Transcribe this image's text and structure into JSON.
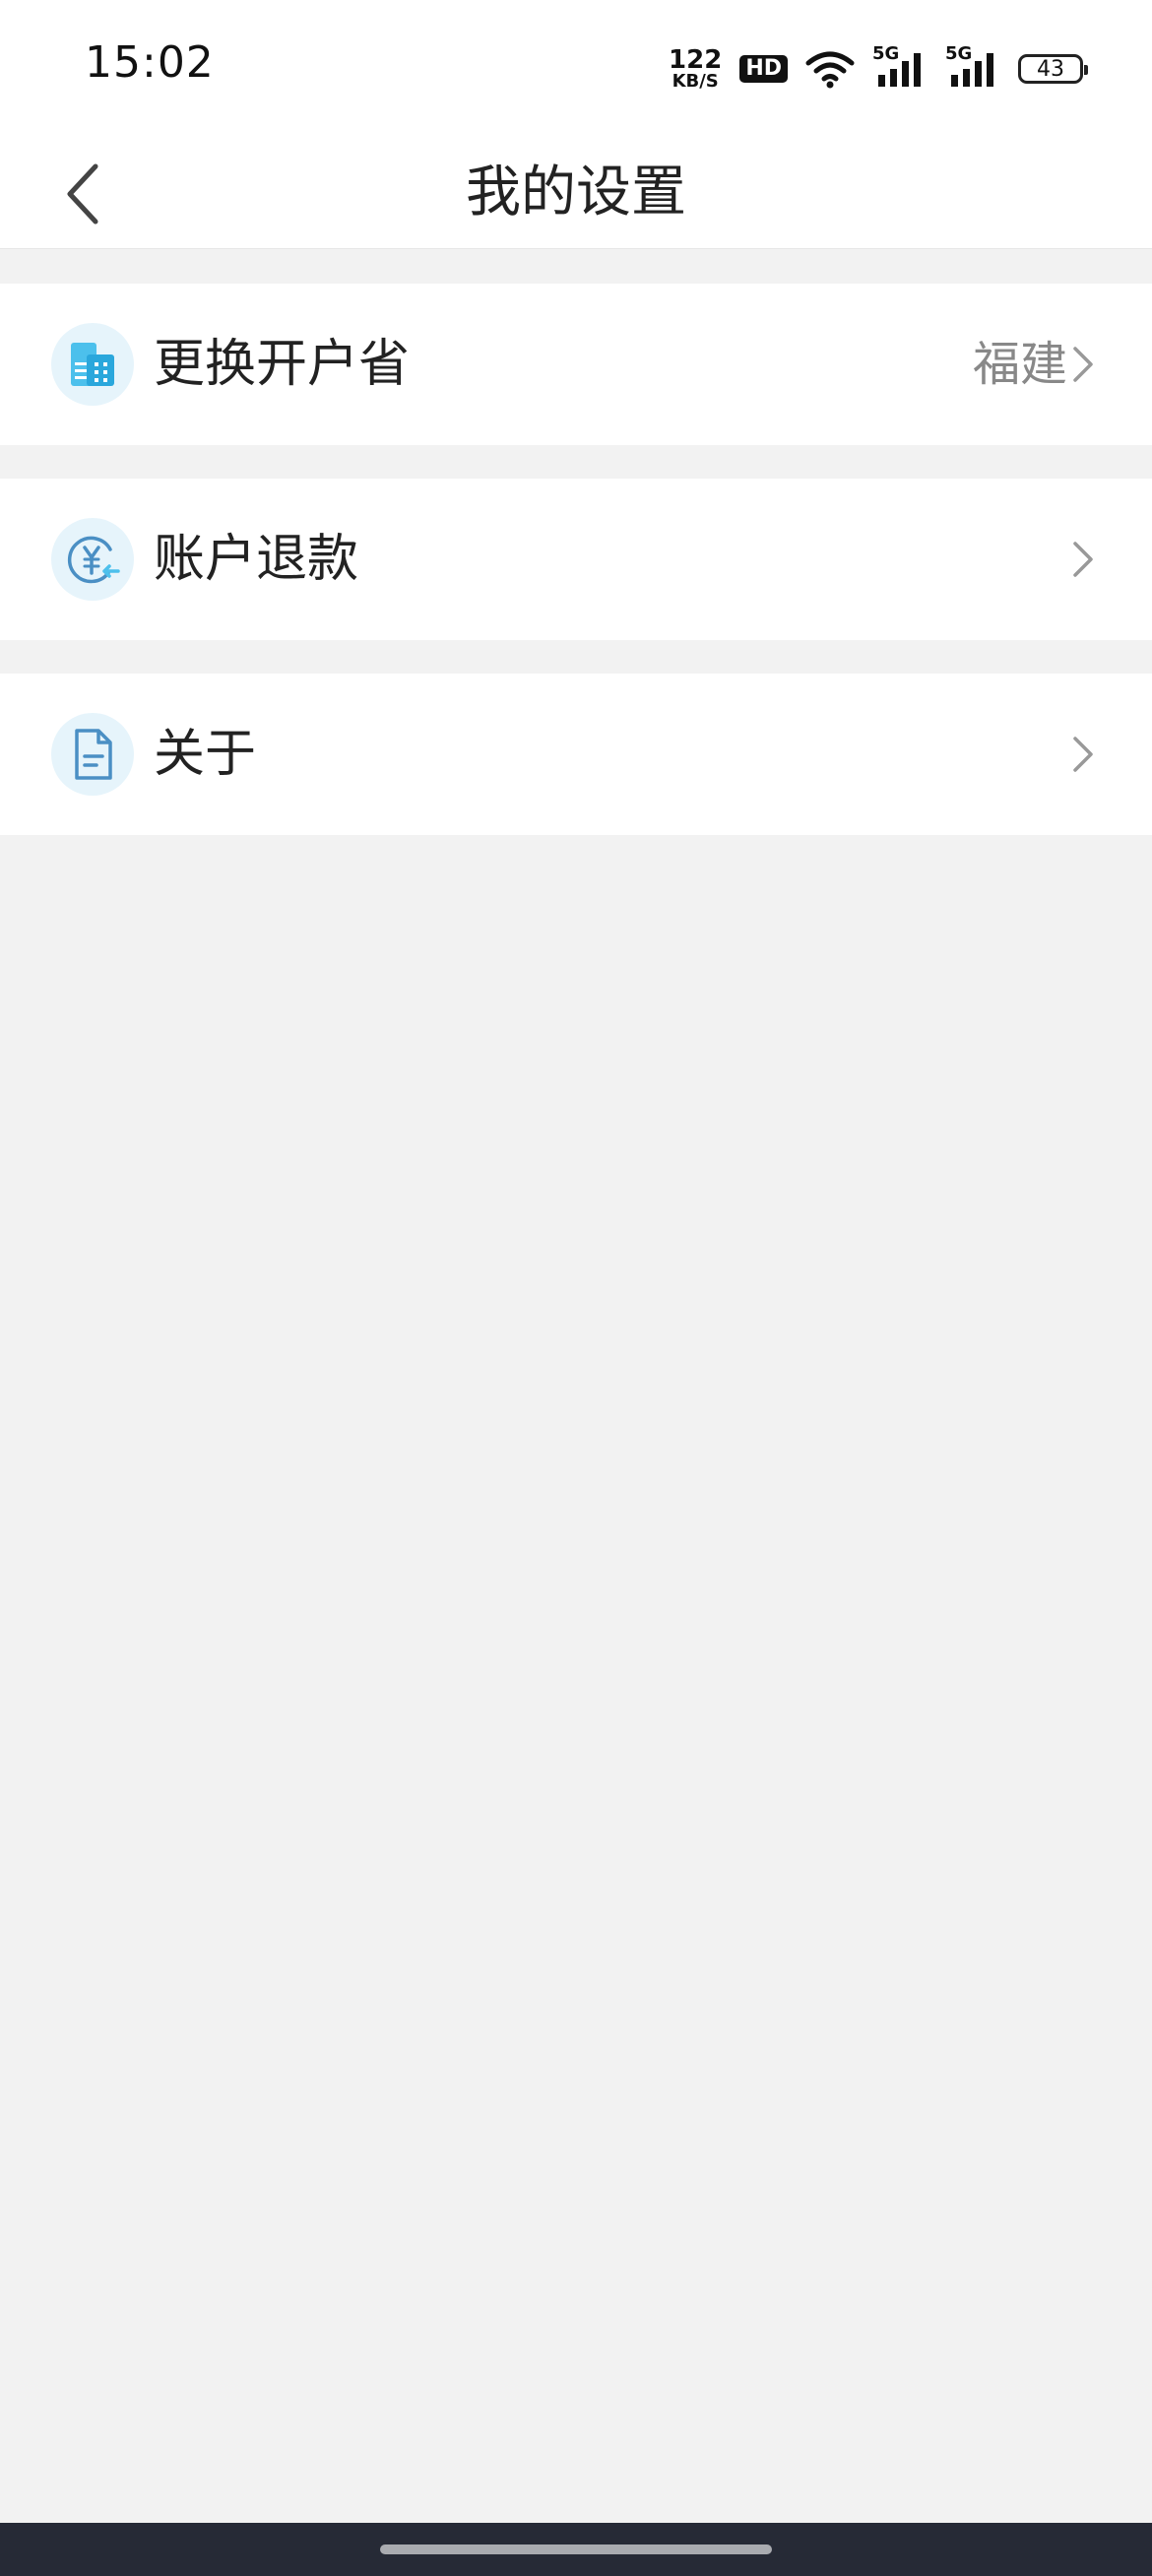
{
  "status_bar": {
    "time": "15:02",
    "net_speed_value": "122",
    "net_speed_unit": "KB/S",
    "hd_label": "HD",
    "network_1": "5G",
    "network_2": "5G",
    "battery": "43"
  },
  "nav": {
    "title": "我的设置"
  },
  "menu": {
    "items": [
      {
        "label": "更换开户省",
        "value": "福建",
        "icon": "building-icon"
      },
      {
        "label": "账户退款",
        "value": "",
        "icon": "refund-yuan-icon"
      },
      {
        "label": "关于",
        "value": "",
        "icon": "document-icon"
      }
    ]
  },
  "colors": {
    "background": "#f2f2f2",
    "card": "#ffffff",
    "icon_bg": "#e6f4fb",
    "icon_accent": "#3ab3e6",
    "bottom_bar": "#262a36"
  }
}
